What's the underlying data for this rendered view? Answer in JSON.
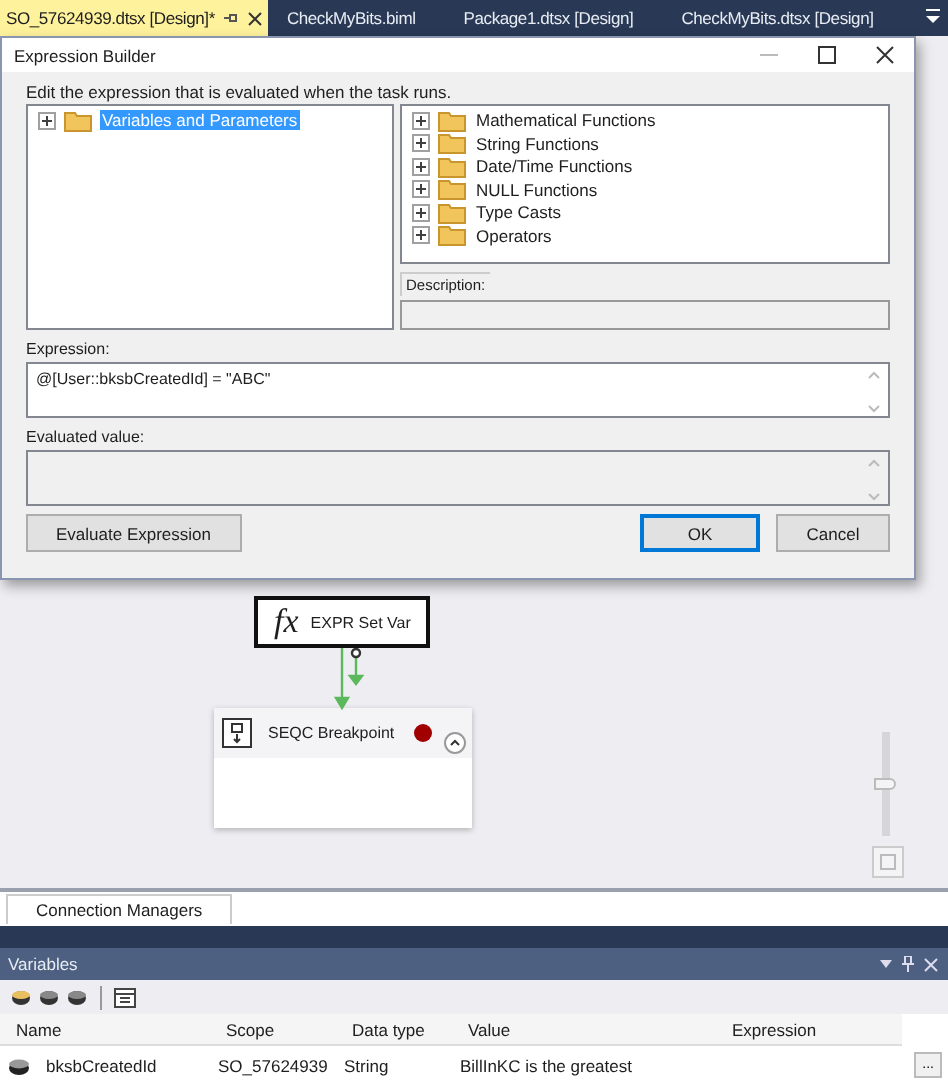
{
  "doc_tabs": [
    {
      "label": "SO_57624939.dtsx [Design]*",
      "selected": true
    },
    {
      "label": "CheckMyBits.biml",
      "selected": false
    },
    {
      "label": "Package1.dtsx [Design]",
      "selected": false
    },
    {
      "label": "CheckMyBits.dtsx [Design]",
      "selected": false
    }
  ],
  "dialog": {
    "title": "Expression Builder",
    "instruction": "Edit the expression that is evaluated when the task runs.",
    "left_tree": [
      {
        "label": "Variables and Parameters",
        "selected": true
      }
    ],
    "right_tree": [
      {
        "label": "Mathematical Functions",
        "selected": false
      },
      {
        "label": "String Functions",
        "selected": false
      },
      {
        "label": "Date/Time Functions",
        "selected": false
      },
      {
        "label": "NULL Functions",
        "selected": false
      },
      {
        "label": "Type Casts",
        "selected": false
      },
      {
        "label": "Operators",
        "selected": false
      }
    ],
    "description_label": "Description:",
    "expression_label": "Expression:",
    "expression": "@[User::bksbCreatedId] = \"ABC\"",
    "evaluated_label": "Evaluated value:",
    "buttons": [
      {
        "label": "Evaluate Expression",
        "default": false
      },
      {
        "label": "OK",
        "default": true
      },
      {
        "label": "Cancel",
        "default": false
      }
    ]
  },
  "canvas": {
    "zoom": {
      "level": 0.5
    },
    "nodes": [
      {
        "kind": "task",
        "icon_text": "fx",
        "label": "EXPR Set Var",
        "selected": true,
        "breakpoint": false
      },
      {
        "kind": "container",
        "label": "SEQC Breakpoint",
        "selected": false,
        "breakpoint": true
      }
    ]
  },
  "bottom_tabs": [
    {
      "label": "Connection Managers"
    }
  ],
  "variables": {
    "title": "Variables",
    "columns": [
      "Name",
      "Scope",
      "Data type",
      "Value",
      "Expression"
    ],
    "rows": [
      {
        "name": "bksbCreatedId",
        "scope": "SO_57624939",
        "data_type": "String",
        "value": "BillInKC is the greatest",
        "edit_button": "..."
      }
    ]
  }
}
